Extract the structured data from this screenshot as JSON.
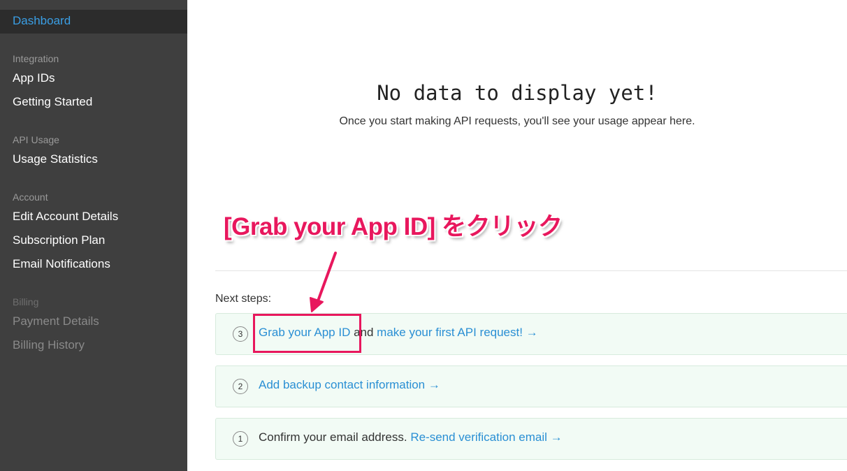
{
  "sidebar": {
    "dashboard": "Dashboard",
    "sections": [
      {
        "heading": "Integration",
        "items": [
          "App IDs",
          "Getting Started"
        ]
      },
      {
        "heading": "API Usage",
        "items": [
          "Usage Statistics"
        ]
      },
      {
        "heading": "Account",
        "items": [
          "Edit Account Details",
          "Subscription Plan",
          "Email Notifications"
        ]
      },
      {
        "heading": "Billing",
        "items": [
          "Payment Details",
          "Billing History"
        ]
      }
    ]
  },
  "main": {
    "empty_title": "No data to display yet!",
    "empty_subtitle": "Once you start making API requests, you'll see your usage appear here.",
    "next_steps_label": "Next steps:",
    "steps": [
      {
        "number": "3",
        "link1": "Grab your App ID",
        "text": " and ",
        "link2": "make your first API request! →"
      },
      {
        "number": "2",
        "link1": "Add backup contact information →"
      },
      {
        "number": "1",
        "text": "Confirm your email address. ",
        "link1": "Re-send verification email →"
      }
    ]
  },
  "annotation": {
    "callout": "[Grab your App ID] をクリック",
    "color": "#e8175d"
  },
  "colors": {
    "sidebar_bg": "#3f3f3f",
    "accent": "#2a8fd4",
    "step_bg": "#f2fbf5"
  }
}
